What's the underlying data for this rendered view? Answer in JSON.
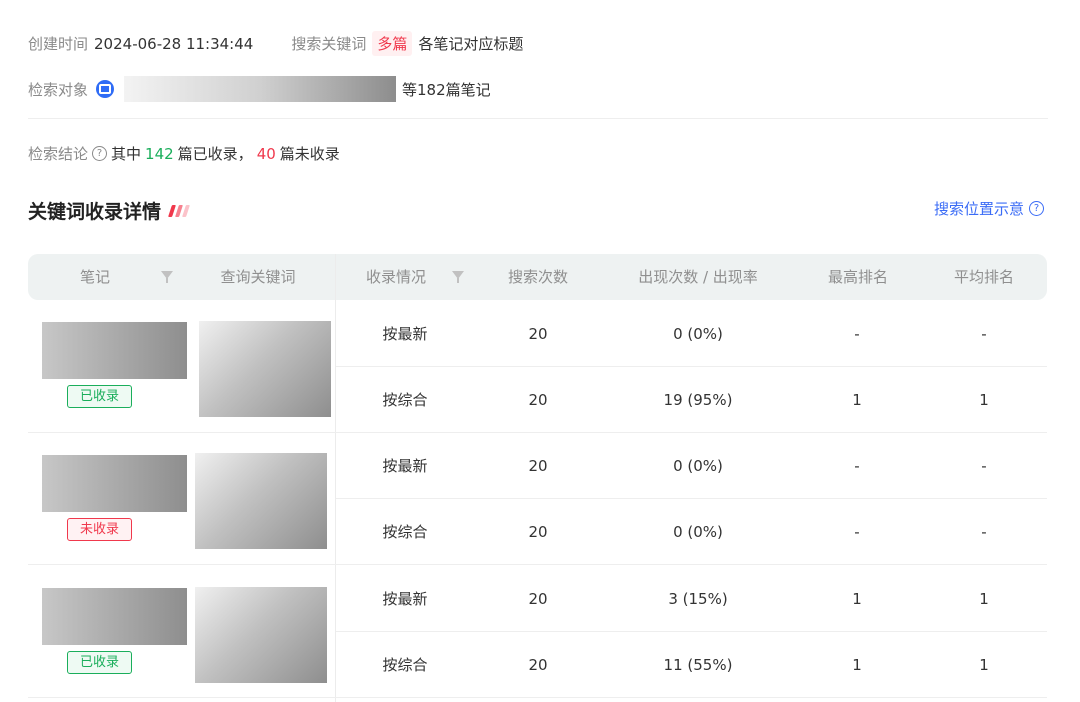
{
  "meta": {
    "created_label": "创建时间",
    "created_time": "2024-06-28 11:34:44",
    "keyword_label": "搜索关键词",
    "keyword_tag": "多篇",
    "keyword_text": "各笔记对应标题",
    "object_label": "检索对象",
    "object_suffix": "等182篇笔记"
  },
  "conclusion": {
    "label": "检索结论",
    "prefix": "其中",
    "included_count": "142",
    "included_text": "篇已收录，",
    "not_included_count": "40",
    "not_included_text": "篇未收录"
  },
  "section": {
    "title": "关键词收录详情",
    "link": "搜索位置示意"
  },
  "colors": {
    "accent_blue": "#3b6cf6",
    "included_green": "#1aae5b",
    "not_included_red": "#f0384c"
  },
  "table": {
    "headers": [
      "笔记",
      "查询关键词",
      "收录情况",
      "搜索次数",
      "出现次数 / 出现率",
      "最高排名",
      "平均排名"
    ],
    "groups": [
      {
        "status": "已收录",
        "rows": [
          {
            "sort": "按最新",
            "searches": "20",
            "appear": "0 (0%)",
            "best": "-",
            "avg": "-"
          },
          {
            "sort": "按综合",
            "searches": "20",
            "appear": "19 (95%)",
            "best": "1",
            "avg": "1"
          }
        ]
      },
      {
        "status": "未收录",
        "rows": [
          {
            "sort": "按最新",
            "searches": "20",
            "appear": "0 (0%)",
            "best": "-",
            "avg": "-"
          },
          {
            "sort": "按综合",
            "searches": "20",
            "appear": "0 (0%)",
            "best": "-",
            "avg": "-"
          }
        ]
      },
      {
        "status": "已收录",
        "rows": [
          {
            "sort": "按最新",
            "searches": "20",
            "appear": "3 (15%)",
            "best": "1",
            "avg": "1"
          },
          {
            "sort": "按综合",
            "searches": "20",
            "appear": "11 (55%)",
            "best": "1",
            "avg": "1"
          }
        ]
      }
    ]
  }
}
